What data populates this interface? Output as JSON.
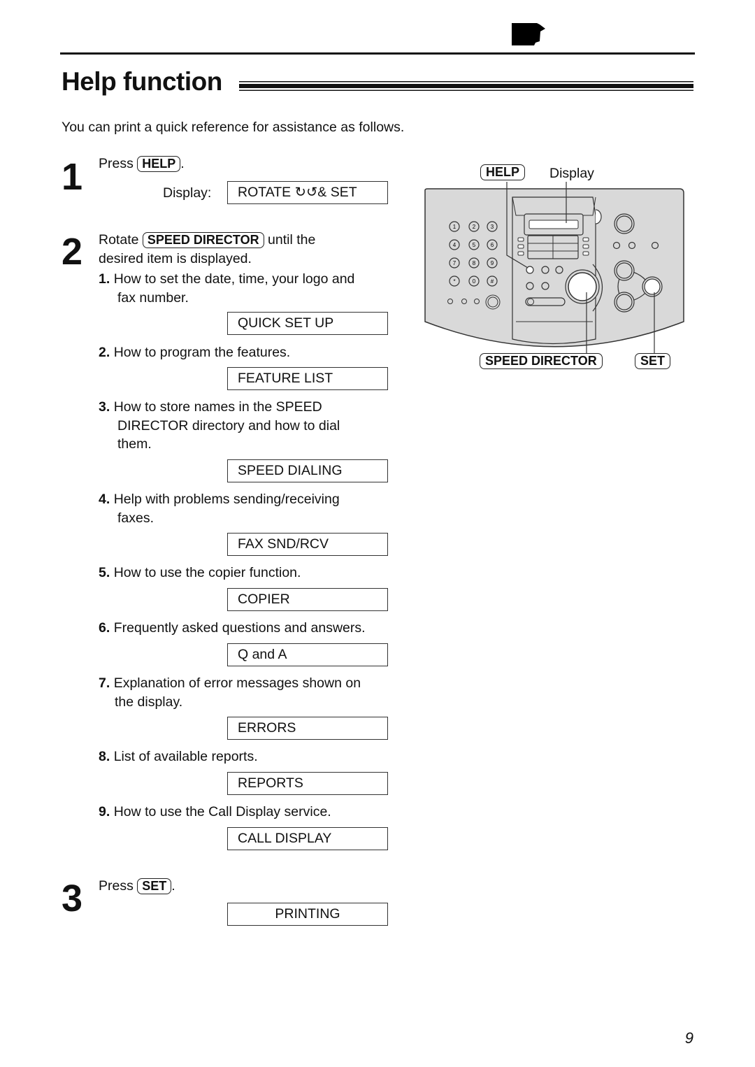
{
  "header": {
    "tab_icon": "black-tab-marker-icon"
  },
  "page": {
    "title": "Help function",
    "intro": "You can print a quick reference for assistance as follows.",
    "page_number": "9"
  },
  "steps": [
    {
      "number": "1",
      "prefix": "Press",
      "key": "HELP",
      "suffix": ".",
      "display_label": "Display:",
      "display_value": "ROTATE ↻↺& SET"
    },
    {
      "number": "2",
      "prefix": "Rotate",
      "key": "SPEED DIRECTOR",
      "suffix": "until the",
      "line2": "desired item is displayed."
    },
    {
      "number": "3",
      "prefix": "Press",
      "key": "SET",
      "suffix": ".",
      "display_value": "PRINTING"
    }
  ],
  "items": [
    {
      "num": "1.",
      "line1": "How to set the date, time, your logo and",
      "line2": "fax number.",
      "display": "QUICK SET UP"
    },
    {
      "num": "2.",
      "line1": "How to program the features.",
      "display": "FEATURE LIST"
    },
    {
      "num": "3.",
      "line1": "How to store names in the SPEED",
      "line2": "DIRECTOR directory and how to dial",
      "line3": "them.",
      "display": "SPEED DIALING"
    },
    {
      "num": "4.",
      "line1": "Help with problems sending/receiving",
      "line2": "faxes.",
      "display": "FAX SND/RCV"
    },
    {
      "num": "5.",
      "line1": "How to use the copier function.",
      "display": "COPIER"
    },
    {
      "num": "6.",
      "line1": "Frequently asked questions and answers.",
      "display": "Q and A"
    },
    {
      "num": "7.",
      "line1": "Explanation of error messages shown on",
      "line2": "the display.",
      "display": "ERRORS"
    },
    {
      "num": "8.",
      "line1": "List of available reports.",
      "display": "REPORTS"
    },
    {
      "num": "9.",
      "line1": "How to use the Call Display service.",
      "display": "CALL DISPLAY"
    }
  ],
  "diagram": {
    "label_help": "HELP",
    "label_display": "Display",
    "label_speed_director": "SPEED DIRECTOR",
    "label_set": "SET",
    "keypad": [
      "1",
      "2",
      "3",
      "4",
      "5",
      "6",
      "7",
      "8",
      "9",
      "*",
      "0",
      "#"
    ],
    "panel_color": "#d9d9d9"
  }
}
